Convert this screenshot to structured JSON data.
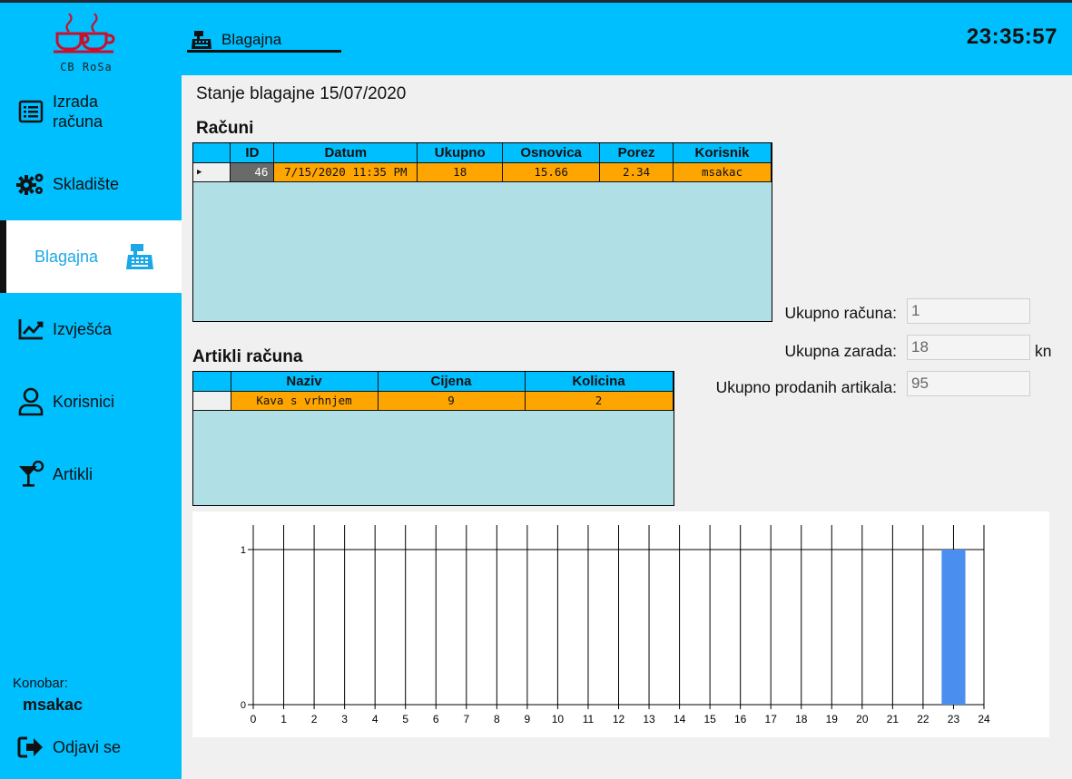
{
  "app": {
    "logo_text": "CB RoSa"
  },
  "sidebar": {
    "items": [
      {
        "label_line1": "Izrada",
        "label_line2": "računa",
        "icon": "list-icon"
      },
      {
        "label": "Skladište",
        "icon": "gears-icon"
      },
      {
        "label": "Blagajna",
        "icon": "cash-register-icon",
        "active": true
      },
      {
        "label": "Izvješća",
        "icon": "line-chart-icon"
      },
      {
        "label": "Korisnici",
        "icon": "user-icon"
      },
      {
        "label": "Artikli",
        "icon": "cocktail-icon"
      }
    ],
    "waiter_label": "Konobar:",
    "waiter_name": "msakac",
    "logout_label": "Odjavi se"
  },
  "header": {
    "tab_label": "Blagajna",
    "clock": "23:35:57"
  },
  "main": {
    "title": "Stanje blagajne 15/07/2020",
    "receipts_title": "Računi",
    "receipts": {
      "columns": [
        "ID",
        "Datum",
        "Ukupno",
        "Osnovica",
        "Porez",
        "Korisnik"
      ],
      "rows": [
        {
          "id": "46",
          "date": "7/15/2020 11:35 PM",
          "total": "18",
          "base": "15.66",
          "tax": "2.34",
          "user": "msakac"
        }
      ]
    },
    "items_title": "Artikli računa",
    "items": {
      "columns": [
        "Naziv",
        "Cijena",
        "Kolicina"
      ],
      "rows": [
        {
          "name": "Kava s vrhnjem",
          "price": "9",
          "qty": "2"
        }
      ]
    },
    "stats": {
      "count_label": "Ukupno računa:",
      "count_value": "1",
      "earnings_label": "Ukupna zarada:",
      "earnings_value": "18",
      "earnings_unit": "kn",
      "sold_label": "Ukupno prodanih artikala:",
      "sold_value": "95"
    }
  },
  "colors": {
    "accent": "#00bfff",
    "row_highlight": "#ffa500",
    "grid_bg": "#b0e0e6",
    "bar": "#4a8ff0"
  },
  "chart_data": {
    "type": "bar",
    "x": [
      0,
      1,
      2,
      3,
      4,
      5,
      6,
      7,
      8,
      9,
      10,
      11,
      12,
      13,
      14,
      15,
      16,
      17,
      18,
      19,
      20,
      21,
      22,
      23,
      24
    ],
    "bars": [
      {
        "x": 23,
        "value": 1
      }
    ],
    "xlim": [
      0,
      24
    ],
    "ylim": [
      0,
      1
    ],
    "yticks": [
      0,
      1
    ],
    "grid": true
  }
}
